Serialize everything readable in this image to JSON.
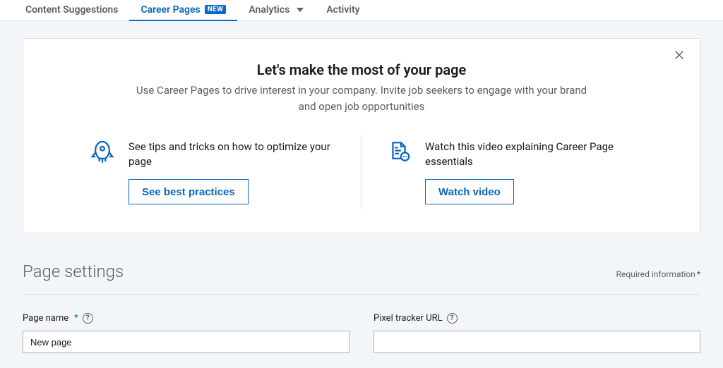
{
  "nav": {
    "tabs": [
      {
        "label": "Content Suggestions",
        "active": false,
        "badge": null,
        "dropdown": false
      },
      {
        "label": "Career Pages",
        "active": true,
        "badge": "NEW",
        "dropdown": false
      },
      {
        "label": "Analytics",
        "active": false,
        "badge": null,
        "dropdown": true
      },
      {
        "label": "Activity",
        "active": false,
        "badge": null,
        "dropdown": false
      }
    ]
  },
  "intro_card": {
    "title": "Let's make the most of your page",
    "subtitle": "Use Career Pages to drive interest in your company. Invite job seekers to engage with your brand and open job opportunities",
    "actions": {
      "left": {
        "icon": "rocket-icon",
        "desc": "See tips and tricks on how to optimize your page",
        "button": "See best practices"
      },
      "right": {
        "icon": "document-chat-icon",
        "desc": "Watch this video explaining Career Page essentials",
        "button": "Watch video"
      }
    }
  },
  "page_settings": {
    "title": "Page settings",
    "required_label": "Required information",
    "fields": {
      "page_name": {
        "label": "Page name",
        "required": true,
        "value": "New page"
      },
      "pixel_tracker": {
        "label": "Pixel tracker URL",
        "required": false,
        "value": ""
      }
    }
  }
}
